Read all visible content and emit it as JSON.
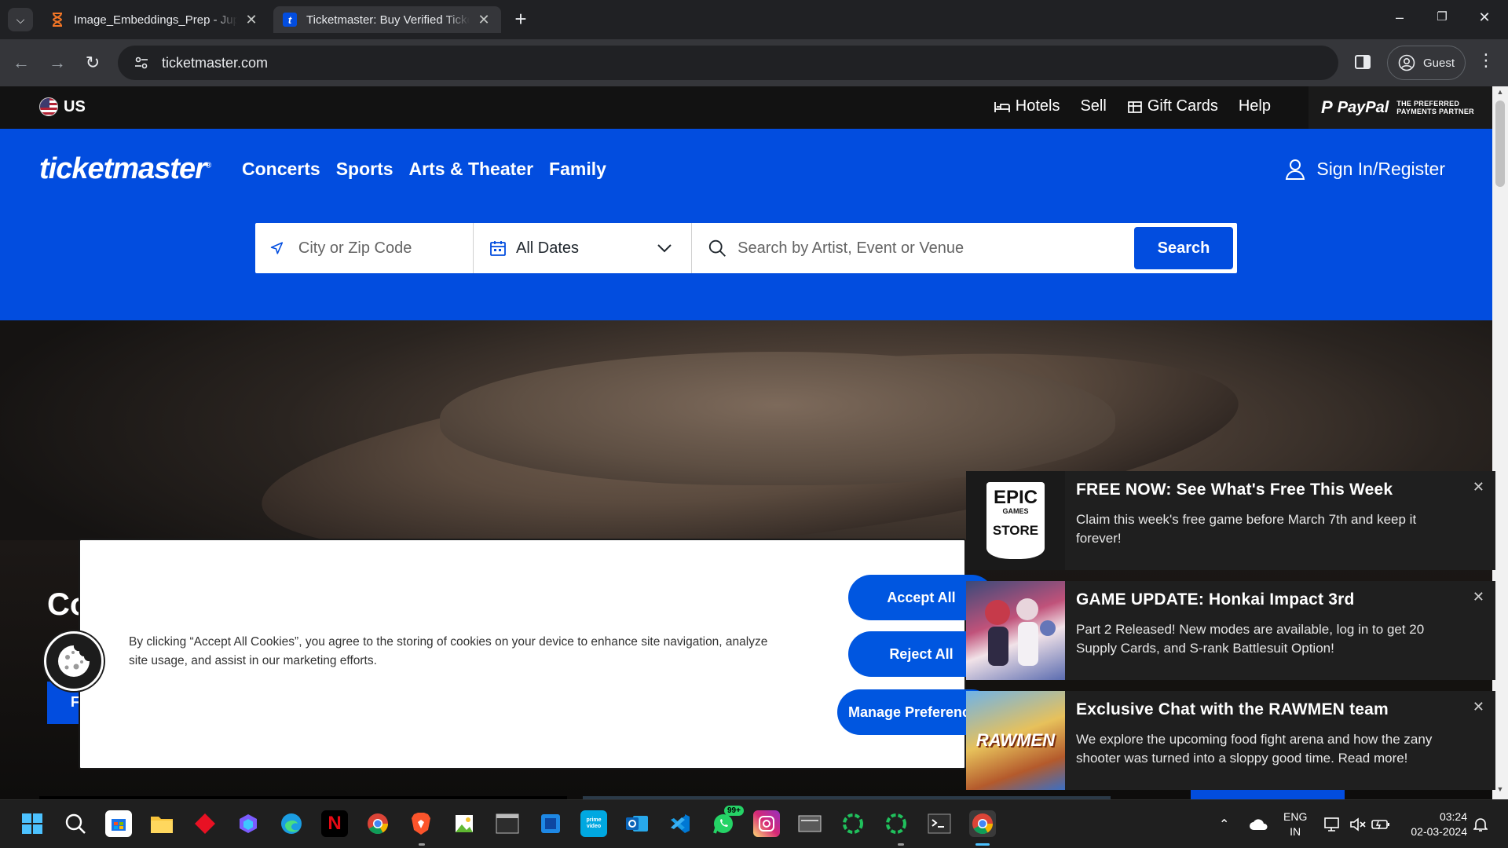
{
  "browser": {
    "tabs": [
      {
        "title": "Image_Embeddings_Prep - Jupyter Notebook",
        "favicon": "hourglass-icon",
        "active": false
      },
      {
        "title": "Ticketmaster: Buy Verified Tickets",
        "favicon": "ticketmaster-t-icon",
        "active": true
      }
    ],
    "url": "ticketmaster.com",
    "profile_label": "Guest"
  },
  "utility_bar": {
    "country": "US",
    "links": [
      {
        "label": "Hotels",
        "icon": "bed-icon"
      },
      {
        "label": "Sell",
        "icon": ""
      },
      {
        "label": "Gift Cards",
        "icon": "gift-card-icon"
      },
      {
        "label": "Help",
        "icon": ""
      }
    ],
    "paypal": {
      "mark": "P",
      "name": "PayPal",
      "tagline_1": "THE PREFERRED",
      "tagline_2": "PAYMENTS PARTNER"
    }
  },
  "header": {
    "logo": "ticketmaster",
    "logo_mark": "®",
    "nav": [
      "Concerts",
      "Sports",
      "Arts & Theater",
      "Family"
    ],
    "sign_in": "Sign In/Register"
  },
  "search": {
    "location_placeholder": "City or Zip Code",
    "dates_value": "All Dates",
    "keyword_placeholder": "Search by Artist, Event or Venue",
    "button": "Search"
  },
  "hero": {
    "title_peek": "Co",
    "button_peek": "F"
  },
  "cookie_banner": {
    "text": "By clicking “Accept All Cookies”, you agree to the storing of cookies on your device to enhance site navigation, analyze site usage, and assist in our marketing efforts.",
    "accept": "Accept All",
    "reject": "Reject All",
    "manage": "Manage Preferences"
  },
  "notifications": [
    {
      "title": "FREE NOW: See What's Free This Week",
      "text": "Claim this week's free game before March 7th and keep it forever!",
      "thumb": "epic-games-store",
      "thumb_lines": [
        "EPIC",
        "GAMES",
        "STORE"
      ]
    },
    {
      "title": "GAME UPDATE: Honkai Impact 3rd",
      "text": "Part 2 Released! New modes are available, log in to get 20 Supply Cards, and S-rank Battlesuit Option!",
      "thumb": "honkai-impact-art"
    },
    {
      "title": "Exclusive Chat with the RAWMEN team",
      "text": "We explore the upcoming food fight arena and how the zany shooter was turned into a sloppy good time. Read more!",
      "thumb": "rawmen-art",
      "thumb_text": "RAWMEN"
    }
  ],
  "taskbar": {
    "apps": [
      "start",
      "search",
      "store",
      "file-explorer",
      "app-red",
      "copilot",
      "edge",
      "netflix",
      "chrome",
      "brave",
      "photo-app",
      "terminal-app",
      "blue-app",
      "prime-video",
      "outlook",
      "vscode",
      "whatsapp",
      "instagram",
      "app-gray",
      "green-ring-1",
      "green-ring-2",
      "command-prompt",
      "chrome-active"
    ],
    "whatsapp_badge": "99+",
    "prime_label": "prime video",
    "language": "ENG",
    "region": "IN",
    "time": "03:24",
    "date": "02-03-2024"
  },
  "colors": {
    "ticketmaster_blue": "#024ddf",
    "cookie_blue": "#0056e0",
    "chrome_dark": "#202124"
  }
}
